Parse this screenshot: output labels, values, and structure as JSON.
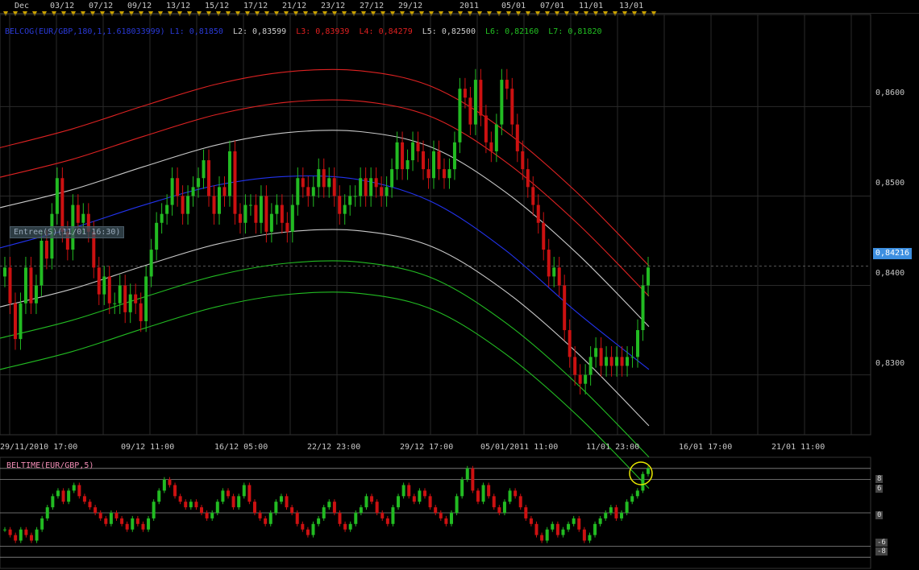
{
  "chart_data": [
    {
      "type": "candlestick",
      "legend": {
        "indicator": "BELCOG(EUR/GBP,180,1,1.618033999)",
        "L1": "L1: 0,81850",
        "L2": "L2: 0,83599",
        "L3": "L3: 0,83939",
        "L4": "L4: 0,84279",
        "L5": "L5: 0,82500",
        "L6": "L6: 0,82160",
        "L7": "L7: 0,81820"
      },
      "top_axis_labels": [
        "Dec",
        "03/12",
        "07/12",
        "09/12",
        "13/12",
        "15/12",
        "17/12",
        "21/12",
        "23/12",
        "27/12",
        "29/12",
        "2011",
        "05/01",
        "07/01",
        "11/01",
        "13/01"
      ],
      "x_tick_labels": [
        "29/11/2010 17:00",
        "09/12 11:00",
        "16/12 05:00",
        "22/12 23:00",
        "29/12 17:00",
        "05/01/2011 11:00",
        "11/01 23:00",
        "16/01 17:00",
        "21/01 11:00"
      ],
      "y_tick_labels": [
        "0,8600",
        "0,8500",
        "0,8400",
        "0,8300"
      ],
      "y_ticks": [
        0.86,
        0.85,
        0.84,
        0.83
      ],
      "ylim": [
        0.8233,
        0.8703
      ],
      "current_price": 0.84216,
      "current_price_label": "0,84216",
      "entry_label": "Entree(S)(11/01 16:30)",
      "entry_price": 0.8434,
      "colors": {
        "up": "#22bb22",
        "down": "#cc1111",
        "center": "#2233ee",
        "upper_red": "#dd2222",
        "white_band": "#cccccc",
        "lower_green": "#22bb22"
      },
      "bands": [
        {
          "color": "red",
          "values": [
            0.8554,
            0.8575,
            0.8601,
            0.8625,
            0.8639,
            0.864,
            0.8622,
            0.8573,
            0.8504,
            0.8422
          ]
        },
        {
          "color": "red",
          "values": [
            0.8521,
            0.8541,
            0.8567,
            0.8591,
            0.8605,
            0.8606,
            0.8588,
            0.8539,
            0.847,
            0.8388
          ]
        },
        {
          "color": "white",
          "values": [
            0.8487,
            0.8507,
            0.8533,
            0.8557,
            0.8571,
            0.8572,
            0.8554,
            0.8505,
            0.8436,
            0.8354
          ]
        },
        {
          "color": "blue",
          "values": [
            0.8442,
            0.8464,
            0.849,
            0.8512,
            0.8522,
            0.8518,
            0.8493,
            0.844,
            0.837,
            0.8306
          ]
        },
        {
          "color": "white",
          "values": [
            0.8376,
            0.8396,
            0.8422,
            0.8446,
            0.846,
            0.8461,
            0.8443,
            0.8394,
            0.8325,
            0.8243
          ]
        },
        {
          "color": "green",
          "values": [
            0.8341,
            0.8361,
            0.8387,
            0.8411,
            0.8425,
            0.8426,
            0.8408,
            0.8359,
            0.829,
            0.8208
          ]
        },
        {
          "color": "green",
          "values": [
            0.8306,
            0.8326,
            0.8352,
            0.8376,
            0.839,
            0.8391,
            0.8373,
            0.8324,
            0.8255,
            0.8173
          ]
        }
      ],
      "candles_close": [
        0.842,
        0.838,
        0.834,
        0.838,
        0.842,
        0.838,
        0.84,
        0.845,
        0.843,
        0.848,
        0.852,
        0.846,
        0.844,
        0.849,
        0.847,
        0.848,
        0.846,
        0.842,
        0.839,
        0.841,
        0.838,
        0.838,
        0.84,
        0.837,
        0.839,
        0.838,
        0.836,
        0.841,
        0.844,
        0.847,
        0.848,
        0.849,
        0.852,
        0.85,
        0.848,
        0.85,
        0.851,
        0.852,
        0.854,
        0.85,
        0.848,
        0.851,
        0.85,
        0.855,
        0.848,
        0.847,
        0.849,
        0.849,
        0.847,
        0.85,
        0.846,
        0.848,
        0.849,
        0.847,
        0.846,
        0.849,
        0.852,
        0.851,
        0.85,
        0.851,
        0.853,
        0.851,
        0.852,
        0.85,
        0.848,
        0.849,
        0.85,
        0.85,
        0.852,
        0.85,
        0.852,
        0.851,
        0.85,
        0.851,
        0.853,
        0.856,
        0.853,
        0.854,
        0.856,
        0.855,
        0.853,
        0.852,
        0.855,
        0.853,
        0.852,
        0.853,
        0.856,
        0.862,
        0.861,
        0.858,
        0.863,
        0.859,
        0.856,
        0.855,
        0.858,
        0.863,
        0.862,
        0.858,
        0.855,
        0.853,
        0.851,
        0.849,
        0.847,
        0.844,
        0.841,
        0.842,
        0.84,
        0.835,
        0.832,
        0.83,
        0.829,
        0.83,
        0.832,
        0.833,
        0.831,
        0.832,
        0.831,
        0.832,
        0.831,
        0.832,
        0.832,
        0.835,
        0.84,
        0.842
      ],
      "candles_open": [
        0.841,
        0.842,
        0.838,
        0.834,
        0.838,
        0.842,
        0.838,
        0.84,
        0.845,
        0.843,
        0.848,
        0.852,
        0.846,
        0.844,
        0.849,
        0.847,
        0.848,
        0.846,
        0.842,
        0.839,
        0.841,
        0.838,
        0.838,
        0.84,
        0.837,
        0.839,
        0.838,
        0.836,
        0.841,
        0.844,
        0.847,
        0.848,
        0.849,
        0.852,
        0.85,
        0.848,
        0.85,
        0.851,
        0.852,
        0.854,
        0.85,
        0.848,
        0.851,
        0.85,
        0.855,
        0.848,
        0.847,
        0.849,
        0.849,
        0.847,
        0.85,
        0.846,
        0.848,
        0.849,
        0.847,
        0.846,
        0.849,
        0.852,
        0.851,
        0.85,
        0.851,
        0.853,
        0.851,
        0.852,
        0.85,
        0.848,
        0.849,
        0.85,
        0.85,
        0.852,
        0.85,
        0.852,
        0.851,
        0.85,
        0.851,
        0.853,
        0.856,
        0.853,
        0.854,
        0.856,
        0.855,
        0.853,
        0.852,
        0.855,
        0.853,
        0.852,
        0.853,
        0.856,
        0.862,
        0.861,
        0.858,
        0.863,
        0.859,
        0.856,
        0.855,
        0.858,
        0.863,
        0.862,
        0.858,
        0.855,
        0.853,
        0.851,
        0.849,
        0.847,
        0.844,
        0.841,
        0.842,
        0.84,
        0.835,
        0.832,
        0.83,
        0.829,
        0.83,
        0.832,
        0.833,
        0.831,
        0.832,
        0.831,
        0.832,
        0.831,
        0.832,
        0.832,
        0.835,
        0.84
      ]
    },
    {
      "type": "bar",
      "title": "BELTIME(EUR/GBP,5)",
      "levels": [
        8,
        6,
        0,
        -6,
        -8
      ],
      "level_labels": [
        "8",
        "6",
        "0",
        "-6",
        "-8"
      ],
      "values": [
        -3,
        -4,
        -5,
        -3,
        -4,
        -5,
        -3,
        -1,
        1,
        3,
        4,
        2,
        4,
        5,
        3,
        2,
        1,
        0,
        -1,
        -2,
        0,
        -1,
        -2,
        -3,
        -1,
        -2,
        -3,
        -1,
        2,
        4,
        6,
        5,
        3,
        2,
        1,
        2,
        1,
        0,
        -1,
        0,
        2,
        4,
        3,
        1,
        3,
        5,
        2,
        0,
        -1,
        -2,
        0,
        2,
        3,
        1,
        0,
        -2,
        -3,
        -4,
        -2,
        -1,
        1,
        2,
        0,
        -2,
        -3,
        -2,
        0,
        1,
        3,
        2,
        0,
        -1,
        -2,
        1,
        3,
        5,
        3,
        2,
        4,
        3,
        1,
        0,
        -1,
        -2,
        0,
        3,
        6,
        8,
        4,
        2,
        5,
        3,
        1,
        0,
        2,
        4,
        3,
        1,
        -1,
        -2,
        -4,
        -5,
        -3,
        -2,
        -4,
        -3,
        -2,
        -1,
        -3,
        -5,
        -4,
        -2,
        -1,
        0,
        1,
        -1,
        0,
        2,
        3,
        4,
        7,
        8
      ]
    }
  ]
}
